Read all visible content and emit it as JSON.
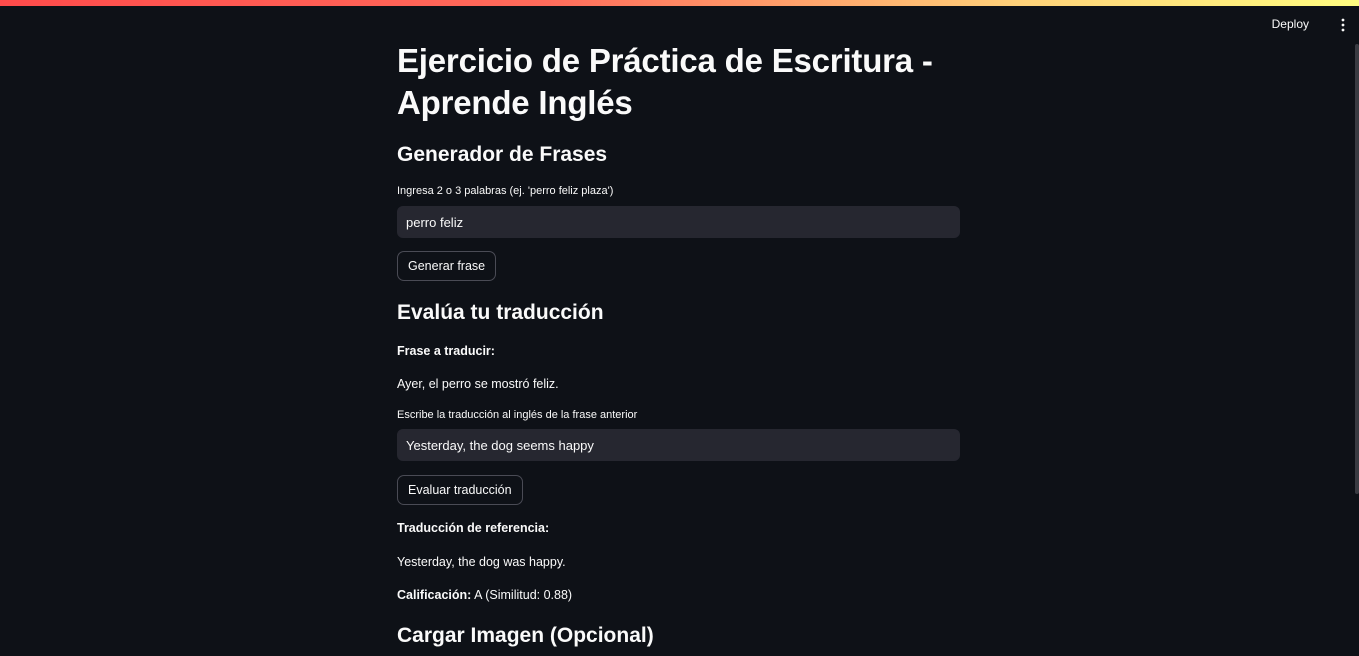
{
  "header": {
    "deploy_label": "Deploy",
    "menu_icon": "vertical-ellipsis-icon"
  },
  "main": {
    "title": "Ejercicio de Práctica de Escritura - Aprende Inglés",
    "generator": {
      "heading": "Generador de Frases",
      "input_label": "Ingresa 2 o 3 palabras (ej. 'perro feliz plaza')",
      "input_value": "perro feliz",
      "button_label": "Generar frase"
    },
    "evaluation": {
      "heading": "Evalúa tu traducción",
      "phrase_label": "Frase a traducir:",
      "phrase_text": "Ayer, el perro se mostró feliz.",
      "translation_label": "Escribe la traducción al inglés de la frase anterior",
      "translation_value": "Yesterday, the dog seems happy",
      "button_label": "Evaluar traducción",
      "reference_label": "Traducción de referencia:",
      "reference_text": "Yesterday, the dog was happy.",
      "grade_label": "Calificación:",
      "grade_value": "A (Similitud: 0.88)"
    },
    "image_upload": {
      "heading": "Cargar Imagen (Opcional)"
    }
  },
  "colors": {
    "background": "#0e1117",
    "input_background": "#262730",
    "text": "#fafafa",
    "accent_gradient_start": "#ff4b4b",
    "accent_gradient_end": "#fffd80"
  }
}
